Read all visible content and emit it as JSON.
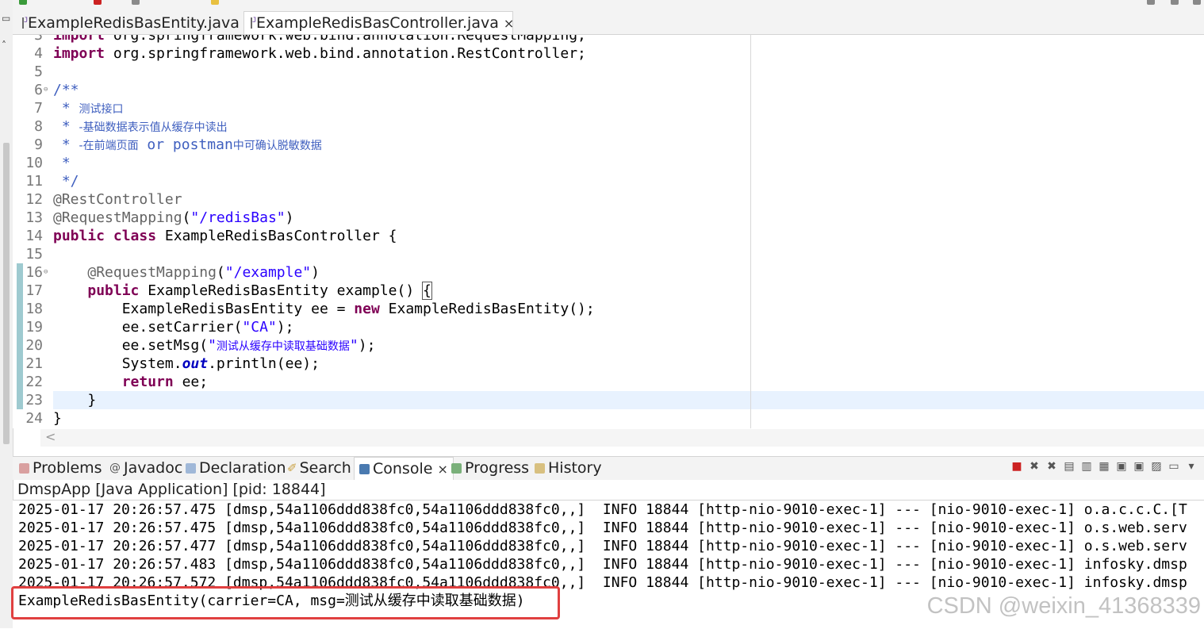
{
  "tabs": [
    {
      "label": "ExampleRedisBasEntity.java",
      "active": false
    },
    {
      "label": "ExampleRedisBasController.java",
      "active": true,
      "close": "×"
    }
  ],
  "editor": {
    "lines": [
      {
        "n": "3",
        "text": "import org.springframework.web.bind.annotation.RequestMapping;"
      },
      {
        "n": "4",
        "text": "import org.springframework.web.bind.annotation.RestController;"
      },
      {
        "n": "5",
        "text": ""
      },
      {
        "n": "6",
        "fold": "⊖",
        "text": "/**"
      },
      {
        "n": "7",
        "text": " * 测试接口"
      },
      {
        "n": "8",
        "text": " * -基础数据表示值从缓存中读出"
      },
      {
        "n": "9",
        "text": " * -在前端页面 or postman中可确认脱敏数据"
      },
      {
        "n": "10",
        "text": " *"
      },
      {
        "n": "11",
        "text": " */"
      },
      {
        "n": "12",
        "text": "@RestController"
      },
      {
        "n": "13",
        "text": "@RequestMapping(\"/redisBas\")"
      },
      {
        "n": "14",
        "text": "public class ExampleRedisBasController {"
      },
      {
        "n": "15",
        "text": ""
      },
      {
        "n": "16",
        "fold": "⊖",
        "text": "    @RequestMapping(\"/example\")"
      },
      {
        "n": "17",
        "text": "    public ExampleRedisBasEntity example() {"
      },
      {
        "n": "18",
        "text": "        ExampleRedisBasEntity ee = new ExampleRedisBasEntity();"
      },
      {
        "n": "19",
        "text": "        ee.setCarrier(\"CA\");"
      },
      {
        "n": "20",
        "text": "        ee.setMsg(\"测试从缓存中读取基础数据\");"
      },
      {
        "n": "21",
        "text": "        System.out.println(ee);"
      },
      {
        "n": "22",
        "text": "        return ee;"
      },
      {
        "n": "23",
        "text": "    }"
      },
      {
        "n": "24",
        "text": "}"
      }
    ]
  },
  "views": {
    "tabs": [
      {
        "label": "Problems",
        "icon": "problems-icon"
      },
      {
        "label": "Javadoc",
        "icon": "javadoc-icon"
      },
      {
        "label": "Declaration",
        "icon": "declaration-icon"
      },
      {
        "label": "Search",
        "icon": "search-icon"
      },
      {
        "label": "Console",
        "icon": "console-icon",
        "active": true,
        "close": "×"
      },
      {
        "label": "Progress",
        "icon": "progress-icon"
      },
      {
        "label": "History",
        "icon": "history-icon"
      }
    ],
    "process": "DmspApp [Java Application]  [pid: 18844]"
  },
  "console": {
    "lines": [
      "2025-01-17 20:26:57.475 [dmsp,54a1106ddd838fc0,54a1106ddd838fc0,,]  INFO 18844 [http-nio-9010-exec-1] --- [nio-9010-exec-1] o.a.c.c.C.[T",
      "2025-01-17 20:26:57.475 [dmsp,54a1106ddd838fc0,54a1106ddd838fc0,,]  INFO 18844 [http-nio-9010-exec-1] --- [nio-9010-exec-1] o.s.web.serv",
      "2025-01-17 20:26:57.477 [dmsp,54a1106ddd838fc0,54a1106ddd838fc0,,]  INFO 18844 [http-nio-9010-exec-1] --- [nio-9010-exec-1] o.s.web.serv",
      "2025-01-17 20:26:57.483 [dmsp,54a1106ddd838fc0,54a1106ddd838fc0,,]  INFO 18844 [http-nio-9010-exec-1] --- [nio-9010-exec-1] infosky.dmsp",
      "2025-01-17 20:26:57.572 [dmsp,54a1106ddd838fc0,54a1106ddd838fc0,,]  INFO 18844 [http-nio-9010-exec-1] --- [nio-9010-exec-1] infosky.dmsp"
    ],
    "output": "ExampleRedisBasEntity(carrier=CA, msg=测试从缓存中读取基础数据)"
  },
  "watermark": "CSDN @weixin_41368339",
  "colors": {
    "keyword": "#7f0055",
    "string": "#2a00ff",
    "comment": "#3f5fbf",
    "highlight_box": "#e04040"
  }
}
